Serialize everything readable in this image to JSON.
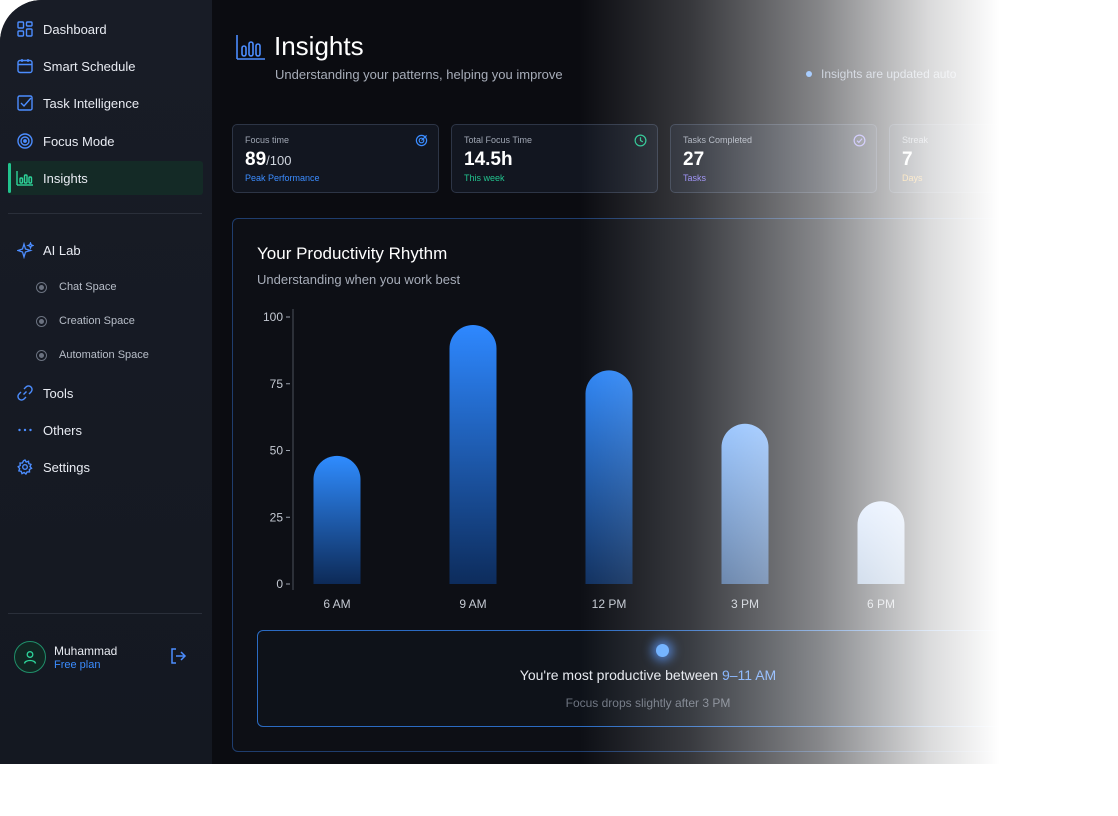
{
  "sidebar": {
    "items": [
      {
        "label": "Dashboard",
        "icon": "grid-icon"
      },
      {
        "label": "Smart Schedule",
        "icon": "calendar-icon"
      },
      {
        "label": "Task Intelligence",
        "icon": "checkbox-icon"
      },
      {
        "label": "Focus Mode",
        "icon": "target-icon"
      },
      {
        "label": "Insights",
        "icon": "bar-chart-icon",
        "active": true
      }
    ],
    "ai_lab": {
      "label": "AI Lab",
      "icon": "sparkle-icon"
    },
    "ai_lab_sub": [
      "Chat Space",
      "Creation Space",
      "Automation Space"
    ],
    "lower_items": [
      {
        "label": "Tools",
        "icon": "link-icon"
      },
      {
        "label": "Others",
        "icon": "dots-icon"
      },
      {
        "label": "Settings",
        "icon": "gear-icon"
      }
    ],
    "user": {
      "name": "Muhammad",
      "plan": "Free plan"
    }
  },
  "header": {
    "title": "Insights",
    "subtitle": "Understanding your patterns, helping you improve",
    "notice": "Insights are updated auto"
  },
  "stats": [
    {
      "label": "Focus time",
      "value": "89",
      "suffix": "/100",
      "note": "Peak Performance",
      "note_color": "#3b8cff",
      "icon": "target-icon",
      "icon_color": "#3b8cff"
    },
    {
      "label": "Total Focus Time",
      "value": "14.5h",
      "suffix": "",
      "note": "This week",
      "note_color": "#22c38e",
      "icon": "clock-icon",
      "icon_color": "#22c38e"
    },
    {
      "label": "Tasks Completed",
      "value": "27",
      "suffix": "",
      "note": "Tasks",
      "note_color": "#8b7cf6",
      "icon": "check-circle-icon",
      "icon_color": "#8b7cf6"
    },
    {
      "label": "Streak",
      "value": "7",
      "suffix": "",
      "note": "Days",
      "note_color": "#f59e0b",
      "icon": "",
      "icon_color": "#f59e0b"
    }
  ],
  "chart": {
    "title": "Your Productivity Rhythm",
    "subtitle": "Understanding when you work best"
  },
  "chart_data": {
    "type": "bar",
    "categories": [
      "6 AM",
      "9 AM",
      "12 PM",
      "3 PM",
      "6 PM"
    ],
    "values": [
      48,
      97,
      80,
      60,
      31
    ],
    "ylim": [
      0,
      100
    ],
    "yticks": [
      0,
      25,
      50,
      75,
      100
    ],
    "grid": false
  },
  "insight": {
    "main_prefix": "You're most productive between ",
    "main_highlight": "9–11 AM",
    "sub": "Focus drops slightly after 3 PM"
  },
  "colors": {
    "accent": "#3b8cff",
    "success": "#22c38e",
    "background": "#0b0c11"
  }
}
